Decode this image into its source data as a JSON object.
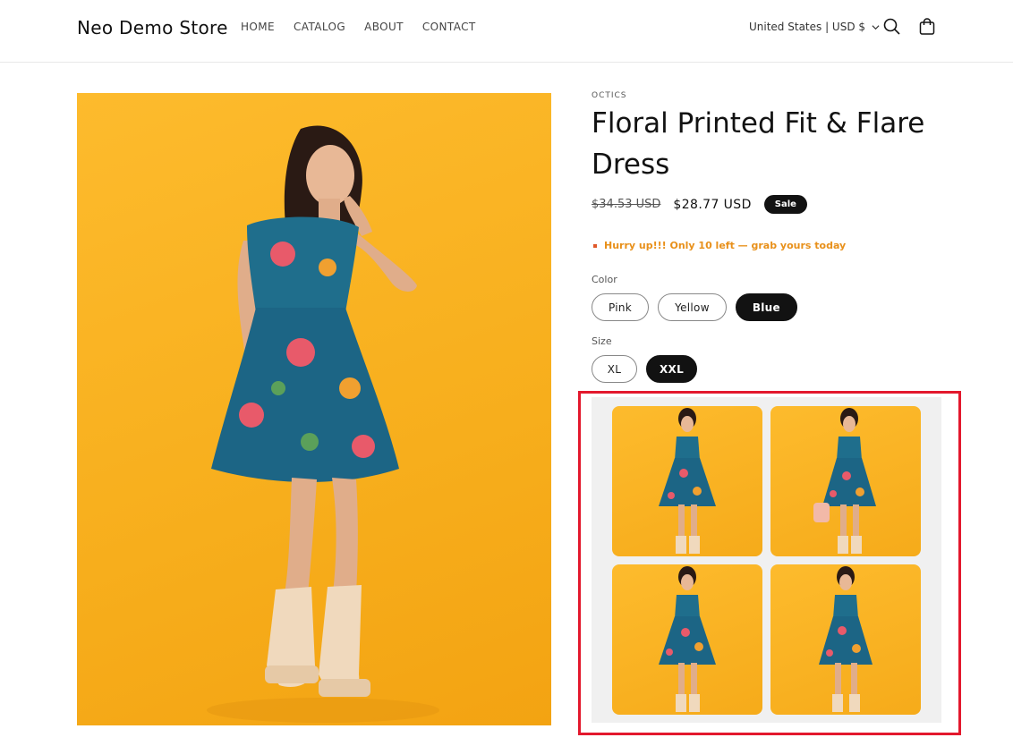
{
  "header": {
    "store_name": "Neo Demo Store",
    "nav": [
      "HOME",
      "CATALOG",
      "ABOUT",
      "CONTACT"
    ],
    "locale": "United States | USD $",
    "icons": [
      "search-icon",
      "cart-icon",
      "chevron-down-icon"
    ]
  },
  "product": {
    "vendor": "OCTICS",
    "title": "Floral Printed Fit & Flare Dress",
    "price_compare": "$34.53 USD",
    "price": "$28.77 USD",
    "badge": "Sale",
    "inventory_notice": "Hurry up!!! Only 10 left — grab yours today",
    "color_label": "Color",
    "colors": [
      "Pink",
      "Yellow",
      "Blue"
    ],
    "selected_color": "Blue",
    "size_label": "Size",
    "sizes": [
      "XL",
      "XXL"
    ],
    "selected_size": "XXL"
  },
  "colors": {
    "accent": "#121212",
    "background_photo": "#fdbb2d",
    "dress": "#1f6e8c",
    "highlight": "#e3182d",
    "notice": "#e8901a"
  }
}
